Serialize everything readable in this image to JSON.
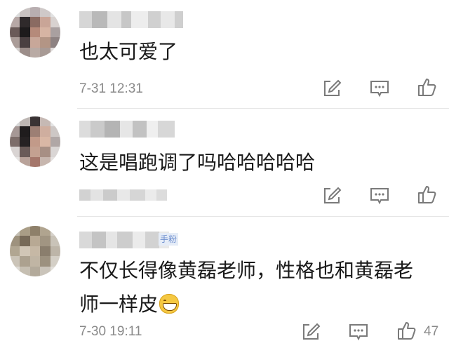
{
  "comments": [
    {
      "text": "也太可爱了",
      "timestamp": "7-31 12:31",
      "likes": ""
    },
    {
      "text": "这是唱跑调了吗哈哈哈哈哈",
      "timestamp": "",
      "likes": ""
    },
    {
      "text_line1": "不仅长得像黄磊老师，性格也和黄磊老",
      "text_line2": "师一样皮",
      "vip_tag": "手粉",
      "timestamp": "7-30 19:11",
      "likes": "47"
    }
  ],
  "icons": {
    "share": "edit-share-icon",
    "reply": "comment-bubble-icon",
    "like": "thumbs-up-icon"
  },
  "colors": {
    "text": "#1a1a1a",
    "meta": "#8a8a8a",
    "icon": "#7a7a7a",
    "divider": "#e6e6e6"
  }
}
